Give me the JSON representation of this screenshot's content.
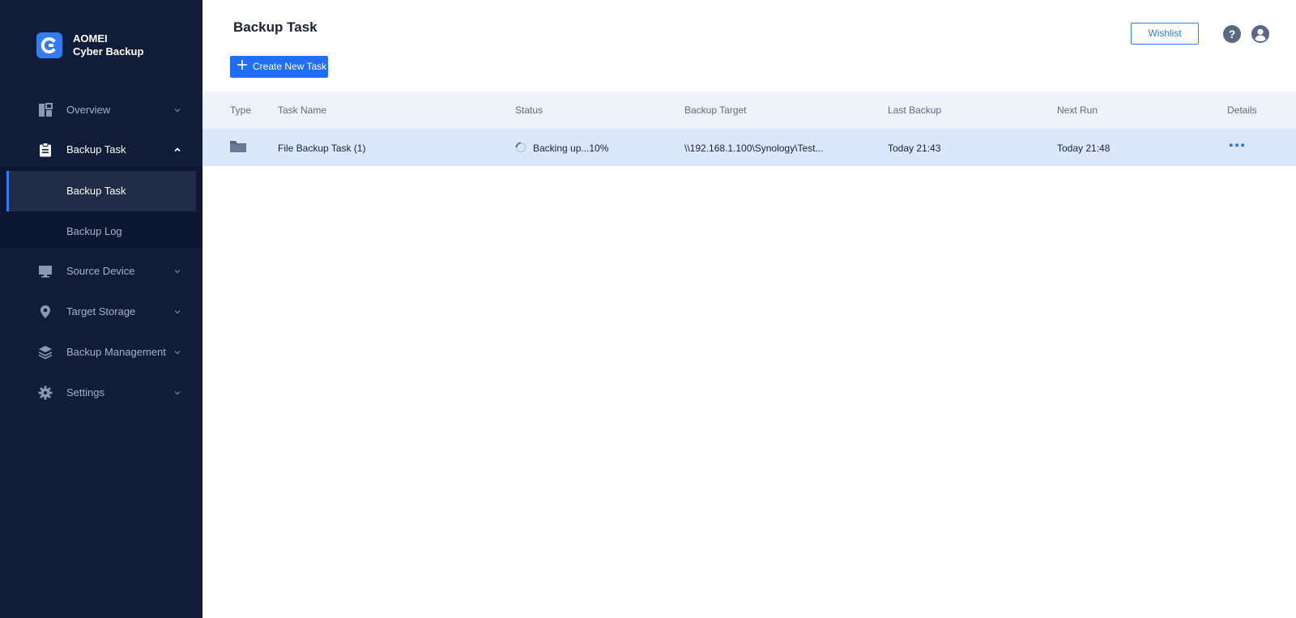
{
  "app": {
    "brand_line1": "AOMEI",
    "brand_line2": "Cyber Backup",
    "accent": "#2f7cf6",
    "sidebar_bg": "#111c38"
  },
  "sidebar": {
    "items": [
      {
        "label": "Overview",
        "icon": "dashboard-icon",
        "expanded": false
      },
      {
        "label": "Backup Task",
        "icon": "clipboard-icon",
        "expanded": true,
        "children": [
          {
            "label": "Backup Task",
            "active": true
          },
          {
            "label": "Backup Log",
            "active": false
          }
        ]
      },
      {
        "label": "Source Device",
        "icon": "monitor-icon",
        "expanded": false
      },
      {
        "label": "Target Storage",
        "icon": "location-pin-icon",
        "expanded": false
      },
      {
        "label": "Backup Management",
        "icon": "layers-icon",
        "expanded": false
      },
      {
        "label": "Settings",
        "icon": "gear-icon",
        "expanded": false
      }
    ]
  },
  "header": {
    "title": "Backup Task",
    "create_button": "Create New Task",
    "wishlist_button": "Wishlist"
  },
  "table": {
    "columns": [
      "Type",
      "Task Name",
      "Status",
      "Backup Target",
      "Last Backup",
      "Next Run",
      "Details"
    ],
    "rows": [
      {
        "type_icon": "folder-icon",
        "task_name": "File Backup Task (1)",
        "status": "Backing up...10%",
        "backup_target": "\\\\192.168.1.100\\Synology\\Test...",
        "last_backup": "Today 21:43",
        "next_run": "Today 21:48",
        "details_icon": "more-dots-icon"
      }
    ]
  }
}
